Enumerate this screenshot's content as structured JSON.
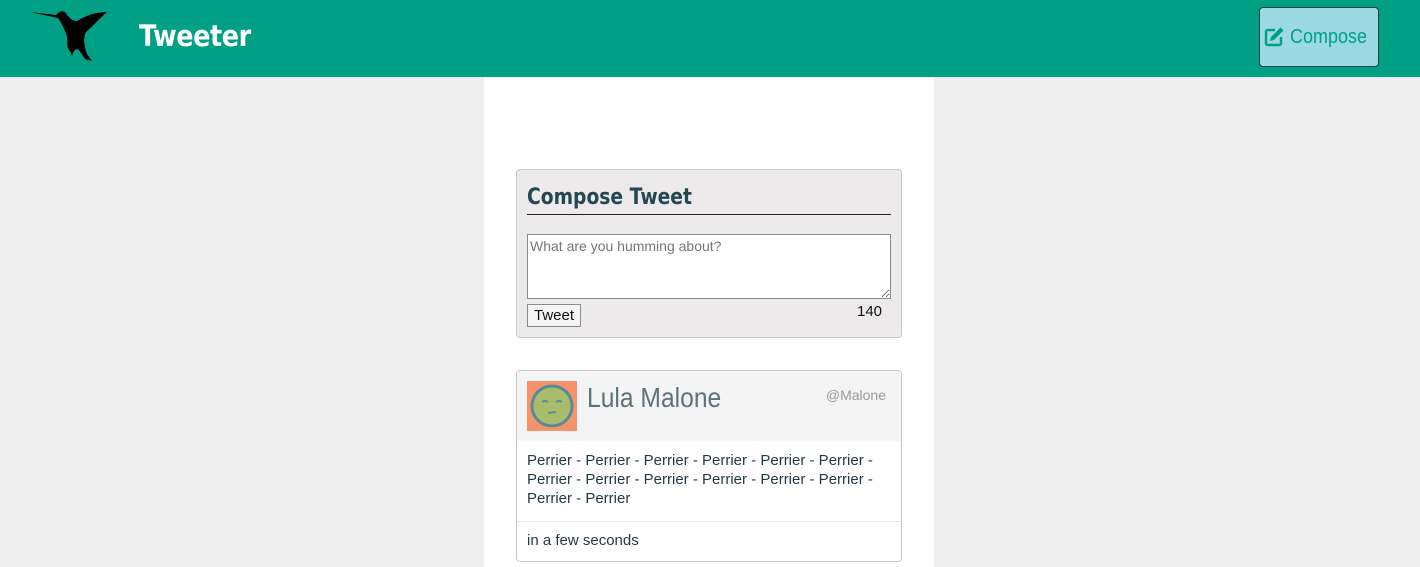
{
  "nav": {
    "brand": "Tweeter",
    "compose_label": "Compose"
  },
  "compose": {
    "heading": "Compose Tweet",
    "placeholder": "What are you humming about?",
    "button_label": "Tweet",
    "counter": "140"
  },
  "tweet": {
    "name": "Lula Malone",
    "handle": "@Malone",
    "content": "Perrier - Perrier - Perrier - Perrier - Perrier - Perrier - Perrier - Perrier - Perrier - Perrier - Perrier - Perrier - Perrier - Perrier",
    "timestamp": "in a few seconds"
  },
  "colors": {
    "nav_bg": "#00a087",
    "compose_button_bg": "#9adae0",
    "heading": "#244751",
    "avatar_bg": "#f5936a",
    "avatar_face": "#a7bd69"
  }
}
